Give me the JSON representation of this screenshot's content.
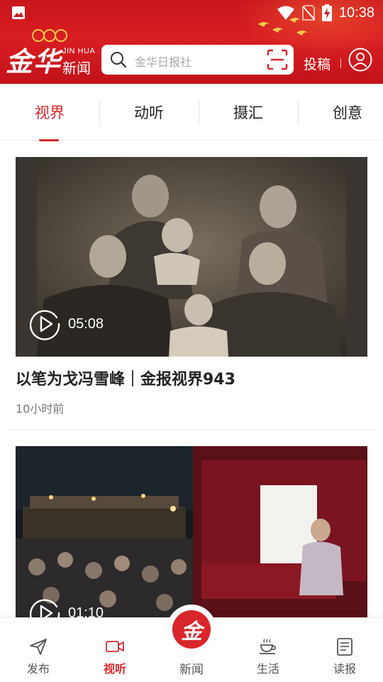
{
  "status_bar": {
    "time": "10:38"
  },
  "header": {
    "logo_main": "金华",
    "logo_en": "JIN HUA",
    "logo_news": "新闻",
    "search_placeholder": "金华日报社",
    "submit_label": "投稿",
    "brand_color": "#d8262a"
  },
  "tabs": [
    {
      "label": "视界",
      "active": true
    },
    {
      "label": "动听",
      "active": false
    },
    {
      "label": "摄汇",
      "active": false
    },
    {
      "label": "创意",
      "active": false
    }
  ],
  "feed": [
    {
      "title": "以笔为戈冯雪峰｜金报视界943",
      "time": "10小时前",
      "duration": "05:08",
      "thumbnail": "vintage family photo"
    },
    {
      "title": "",
      "time": "",
      "duration": "01:10",
      "thumbnail": "night shadow puppet show"
    }
  ],
  "bottom_nav": [
    {
      "label": "发布",
      "icon": "send-icon",
      "active": false
    },
    {
      "label": "视听",
      "icon": "video-icon",
      "active": true
    },
    {
      "label": "新闻",
      "icon": "jin-logo-icon",
      "active": false,
      "center_glyph": "金"
    },
    {
      "label": "生活",
      "icon": "coffee-cup-icon",
      "active": false
    },
    {
      "label": "读报",
      "icon": "newspaper-icon",
      "active": false
    }
  ]
}
